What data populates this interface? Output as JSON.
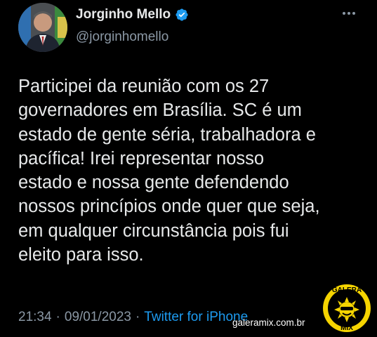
{
  "tweet": {
    "display_name": "Jorginho Mello",
    "handle": "@jorginhomello",
    "text": "Participei da reunião com os 27\ngovernadores em Brasília. SC é um\nestado de gente séria, trabalhadora e\npacífica! Irei representar nosso\nestado e nossa gente defendendo\nnossos princípios onde quer que seja,\nem qualquer circunstância pois fui\neleito para isso.",
    "time": "21:34",
    "separator": "·",
    "date": "09/01/2023",
    "source": "Twitter for iPhone"
  },
  "watermark": {
    "site": "galeramix.com.br",
    "logo_text_top": "GALERA",
    "logo_text_bottom": "MIX"
  },
  "icons": {
    "verified": "verified-badge-icon",
    "more": "more-options-icon"
  },
  "colors": {
    "background": "#000000",
    "text": "#e7e9ea",
    "secondary": "#8b98a5",
    "link": "#1d9bf0",
    "verified": "#1d9bf0",
    "logo_yellow": "#f5d400"
  }
}
